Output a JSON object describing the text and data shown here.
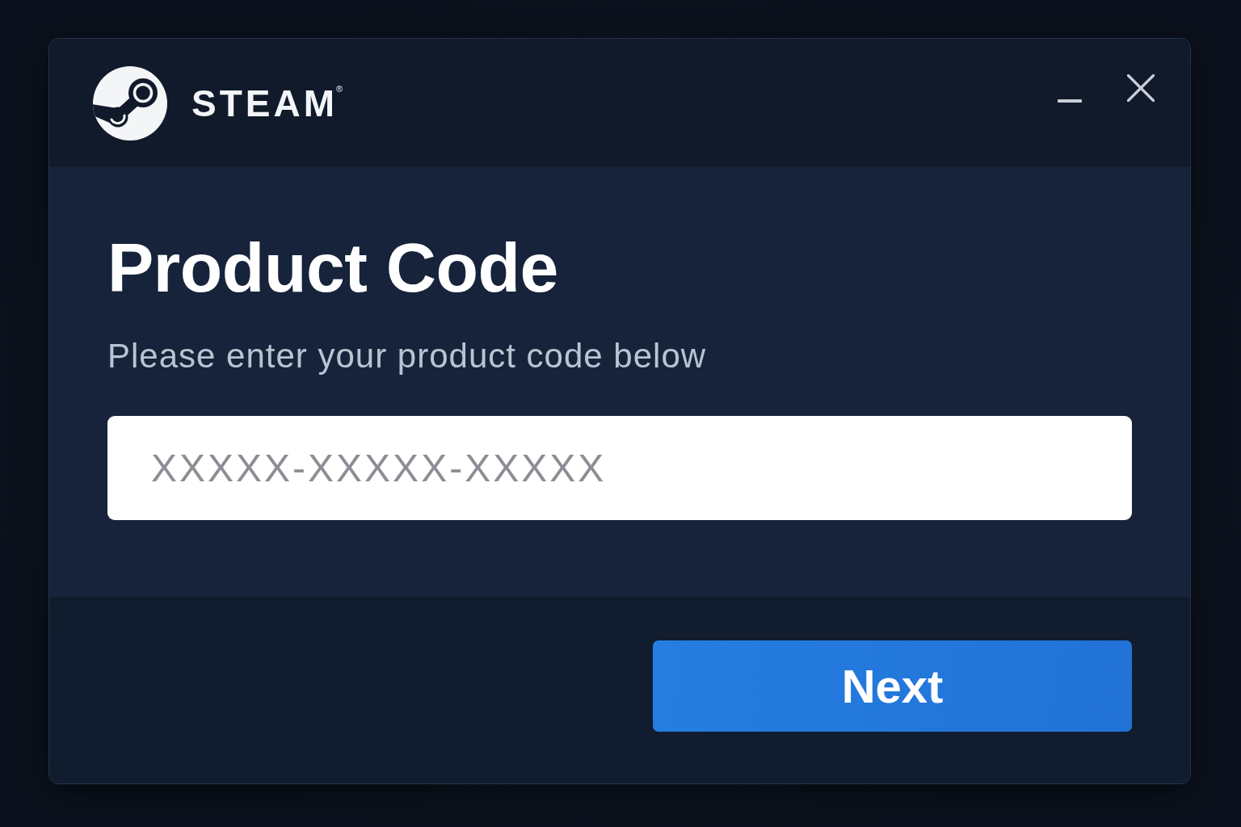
{
  "window": {
    "brand": "STEAM$^{®}$"
  },
  "title": "Product Code",
  "instructions": "Please enter your product code below",
  "code_field": {
    "placeholder": "XXXXX-XXXXX-XXXXX"
  },
  "buttons": [
    "Next"
  ]
}
